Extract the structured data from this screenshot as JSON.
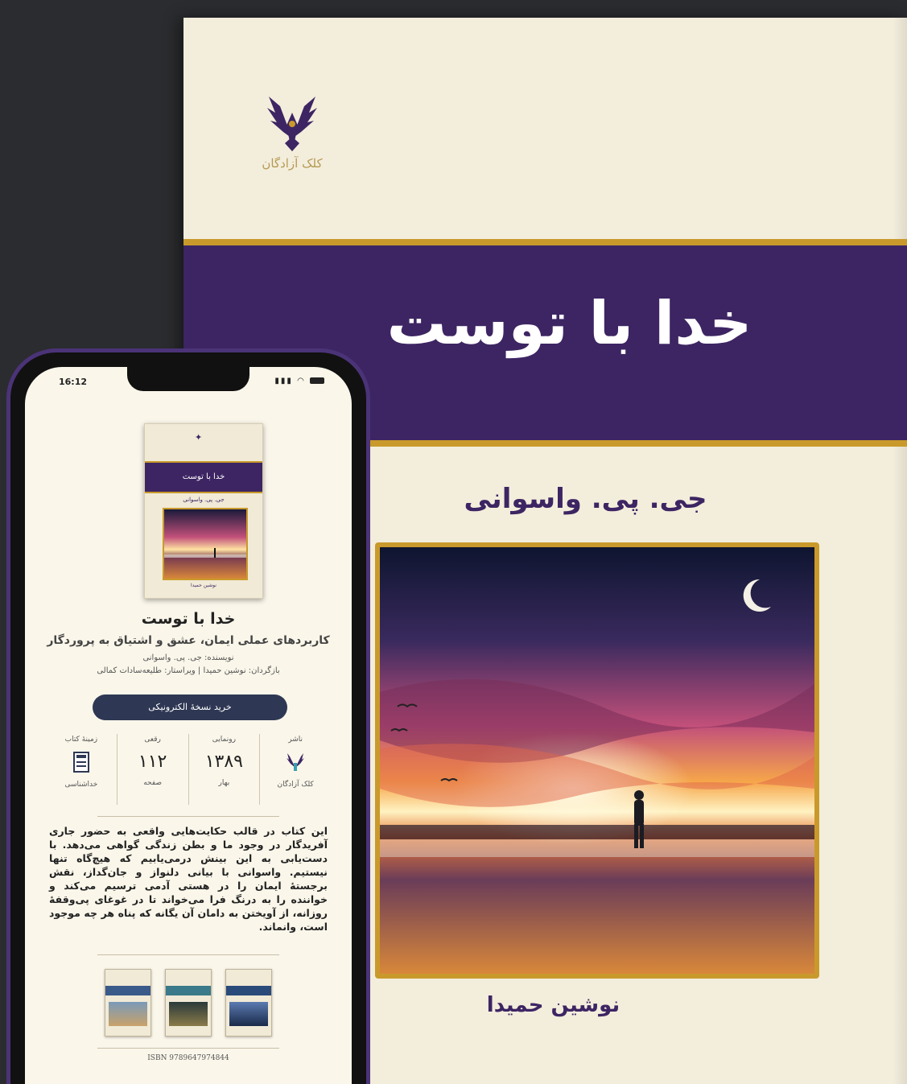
{
  "cover": {
    "publisher_logo_text": "کلک آزادگان",
    "title": "خدا با توست",
    "author": "جی. پی. واسوانی",
    "translator": "نوشین حمیدا",
    "colors": {
      "band": "#3d2563",
      "gold": "#c99a2b",
      "paper": "#f3eddc"
    }
  },
  "phone": {
    "status_time": "16:12",
    "status_icons": "signal wifi battery",
    "mini_cover": {
      "title": "خدا با توست",
      "author": "جی. پی. واسوانی",
      "translator": "نوشین حمیدا"
    },
    "book_title": "خدا با توست",
    "subtitle": "کاربردهای عملی ایمان، عشق و اشتیاق به پروردگار",
    "author_line": "نویسنده: جی. پی. واسوانی",
    "translator_line": "بازگردان: نوشین حمیدا | ویراستار: طلیعه‌سادات کمالی",
    "buy_button": "خرید نسخهٔ الکترونیکی",
    "stats": [
      {
        "label": "ناشر",
        "sub": "کلک آزادگان",
        "icon": "publisher-logo-icon"
      },
      {
        "label": "رونمایی",
        "value": "۱۳۸۹",
        "sub": "بهار"
      },
      {
        "label": "رقعی",
        "value": "۱۱۲",
        "sub": "صفحه"
      },
      {
        "label": "زمینهٔ کتاب",
        "sub": "خداشناسی",
        "icon": "book-category-icon"
      }
    ],
    "description": "این کتاب در قالب حکایت‌هایی واقعی به حضور جاری آفریدگار در وجود ما و بطن زندگی گواهی می‌دهد. با دست‌یابی به این بینش درمی‌یابیم که هیچ‌گاه تنها نیستیم. واسوانی با بیانی دلنواز و جان‌گداز، نقش برجستهٔ ایمان را در هستی آدمی ترسیم می‌کند و خواننده را به درنگ فرا می‌خواند تا در غوغای پی‌وقفهٔ روزانه، از آویختن به دامان آن یگانه که پناه هر چه موجود است، وانماند.",
    "isbn": "ISBN 9789647974844"
  }
}
